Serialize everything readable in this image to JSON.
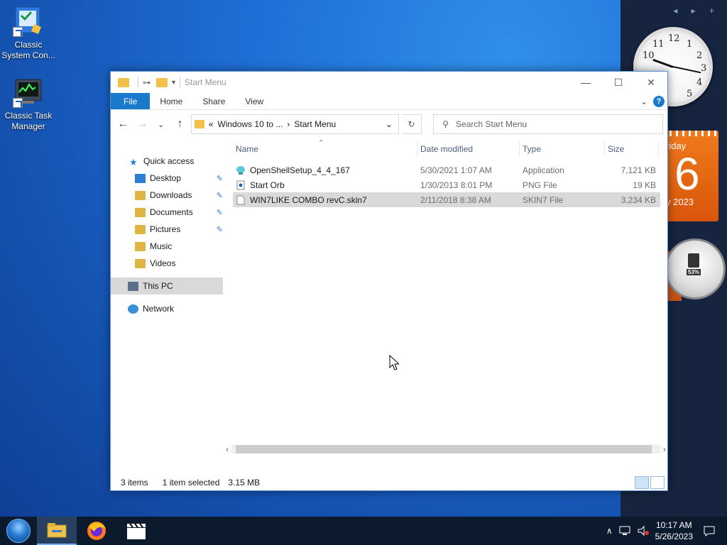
{
  "desktop": {
    "icons": [
      {
        "label": "Classic System Con...",
        "icon": "control-panel-icon"
      },
      {
        "label": "Classic Task Manager",
        "icon": "task-manager-icon"
      }
    ]
  },
  "gadgets": {
    "sidebar_controls": "◂ ▸ +",
    "clock_numbers": [
      "12",
      "1",
      "2",
      "3",
      "4",
      "5",
      "10",
      "11"
    ],
    "calendar": {
      "weekday": "riday",
      "day": "6",
      "month_year": "y 2023"
    },
    "gauge_label": "53%"
  },
  "window": {
    "title": "Start Menu",
    "controls": {
      "minimize": "—",
      "maximize": "☐",
      "close": "✕"
    },
    "ribbon": {
      "tabs": [
        "File",
        "Home",
        "Share",
        "View"
      ],
      "expand": "⌄",
      "help": "?"
    },
    "address": {
      "chevron": "«",
      "crumbs": [
        "Windows 10 to ...",
        "Start Menu"
      ],
      "arrow": "›",
      "dropdown": "⌄",
      "refresh": "↻"
    },
    "search": {
      "placeholder": "Search Start Menu"
    },
    "nav_buttons": {
      "back": "←",
      "forward": "→",
      "recent": "⌄",
      "up": "↑"
    },
    "nav": {
      "quick_access": "Quick access",
      "items": [
        {
          "label": "Desktop",
          "color": "#2d7fd6"
        },
        {
          "label": "Downloads",
          "color": "#2d7fd6"
        },
        {
          "label": "Documents",
          "color": "#e0b544"
        },
        {
          "label": "Pictures",
          "color": "#e0b544"
        },
        {
          "label": "Music",
          "color": "#e0b544"
        },
        {
          "label": "Videos",
          "color": "#e0b544"
        }
      ],
      "this_pc": "This PC",
      "network": "Network"
    },
    "columns": {
      "name": "Name",
      "date": "Date modified",
      "type": "Type",
      "size": "Size",
      "sort_indicator": "^"
    },
    "files": [
      {
        "name": "OpenShellSetup_4_4_167",
        "date": "5/30/2021 1:07 AM",
        "type": "Application",
        "size": "7,121 KB",
        "icon": "installer-icon",
        "selected": false
      },
      {
        "name": "Start Orb",
        "date": "1/30/2013 8:01 PM",
        "type": "PNG File",
        "size": "19 KB",
        "icon": "image-file-icon",
        "selected": false
      },
      {
        "name": "WIN7LIKE COMBO revC.skin7",
        "date": "2/11/2018 8:38 AM",
        "type": "SKIN7 File",
        "size": "3,234 KB",
        "icon": "generic-file-icon",
        "selected": true
      }
    ],
    "scroll": {
      "left": "‹",
      "right": "›"
    },
    "status": {
      "items": "3 items",
      "selected": "1 item selected",
      "size": "3.15 MB"
    }
  },
  "taskbar": {
    "time": "10:17 AM",
    "date": "5/26/2023",
    "tray": {
      "chevron": "∧"
    }
  }
}
